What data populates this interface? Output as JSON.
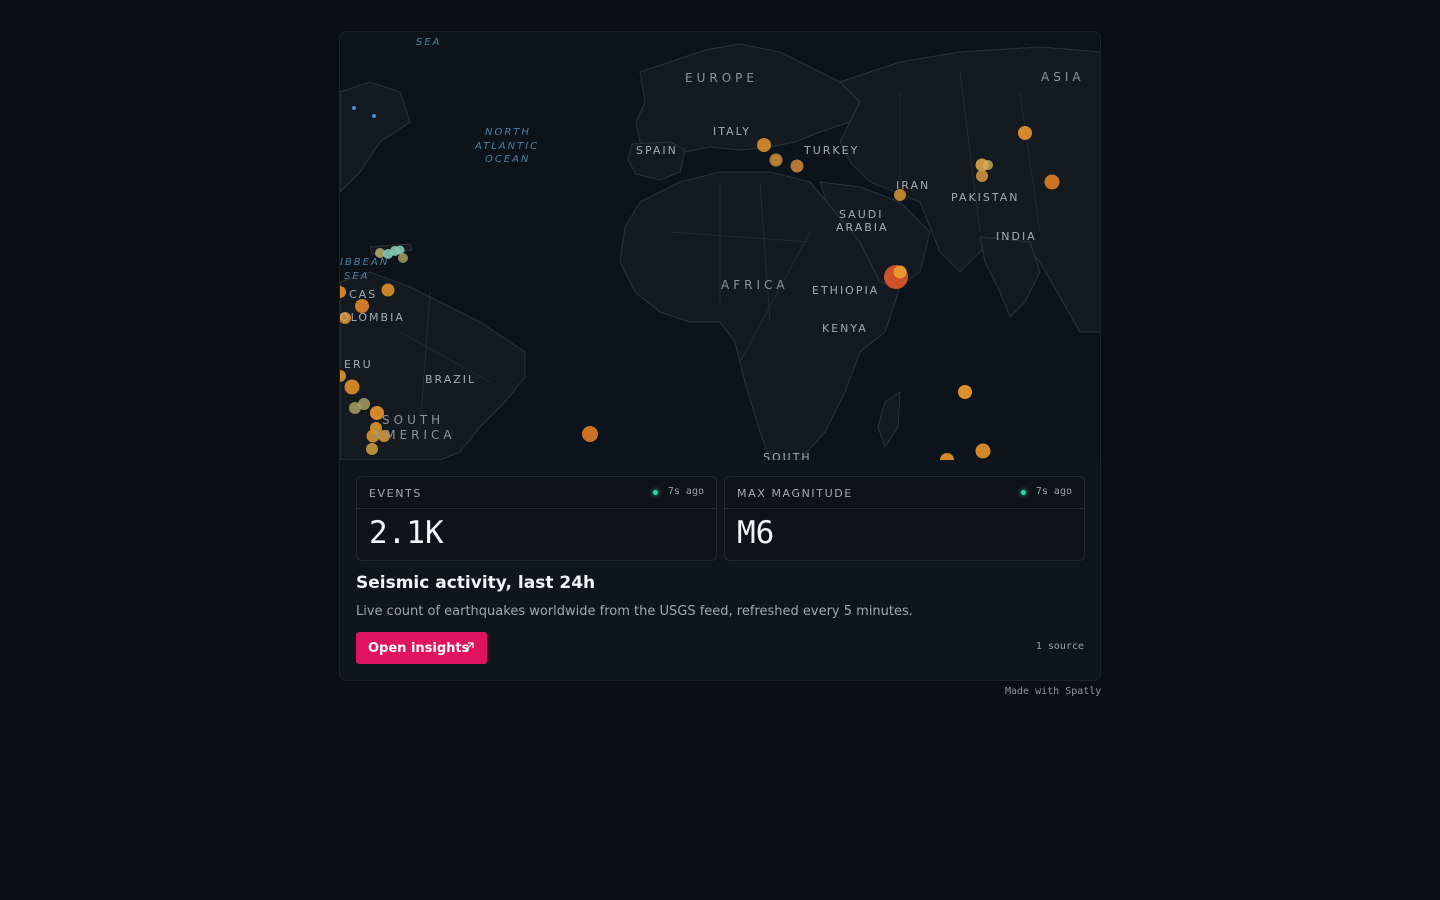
{
  "map": {
    "labels": {
      "sea_top": "SEA",
      "north_atlantic": "NORTH",
      "north_atlantic_2": "ATLANTIC",
      "north_atlantic_3": "OCEAN",
      "caribbean": "IBBEAN",
      "caribbean_2": "SEA",
      "europe": "EUROPE",
      "asia": "ASIA",
      "italy": "ITALY",
      "spain": "SPAIN",
      "turkey": "TURKEY",
      "iran": "IRAN",
      "pakistan": "PAKISTAN",
      "saudi": "SAUDI",
      "arabia": "ARABIA",
      "india": "INDIA",
      "africa": "AFRICA",
      "ethiopia": "ETHIOPIA",
      "kenya": "KENYA",
      "cas": "CAS",
      "colombia": "OLOMBIA",
      "peru": "ERU",
      "brazil": "BRAZIL",
      "south_america": "SOUTH",
      "south_america_2": "AMERICA",
      "south": "SOUTH"
    },
    "colors": {
      "land": "#151a21",
      "border": "#2b323c",
      "water": "#0d131b",
      "quake_orange": "#e8962a",
      "quake_red": "#d9542a",
      "quake_teal": "#7fc8b8"
    }
  },
  "stats": [
    {
      "title": "EVENTS",
      "age": "7s ago",
      "value": "2.1K"
    },
    {
      "title": "MAX MAGNITUDE",
      "age": "7s ago",
      "value": "M6"
    }
  ],
  "content": {
    "title": "Seismic activity, last 24h",
    "description": "Live count of earthquakes worldwide from the USGS feed, refreshed every 5 minutes.",
    "button_label": "Open insights",
    "sources": "1 source"
  },
  "footer": "Made with Spatly"
}
